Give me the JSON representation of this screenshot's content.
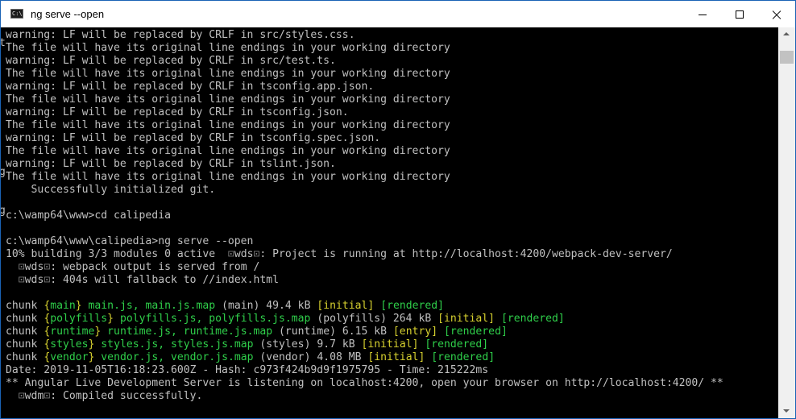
{
  "window": {
    "title": "ng serve --open",
    "icon": "cmd-icon",
    "icon_glyph": "C:\\",
    "buttons": {
      "minimize": "minimize-icon",
      "maximize": "maximize-icon",
      "close": "close-icon"
    }
  },
  "terminal": {
    "lines": [
      {
        "segments": [
          {
            "text": "warning: LF will be replaced by CRLF in src/styles.css."
          }
        ]
      },
      {
        "segments": [
          {
            "text": "The file will have its original line endings in your working directory"
          }
        ]
      },
      {
        "segments": [
          {
            "text": "warning: LF will be replaced by CRLF in src/test.ts."
          }
        ]
      },
      {
        "segments": [
          {
            "text": "The file will have its original line endings in your working directory"
          }
        ]
      },
      {
        "segments": [
          {
            "text": "warning: LF will be replaced by CRLF in tsconfig.app.json."
          }
        ]
      },
      {
        "segments": [
          {
            "text": "The file will have its original line endings in your working directory"
          }
        ]
      },
      {
        "segments": [
          {
            "text": "warning: LF will be replaced by CRLF in tsconfig.json."
          }
        ]
      },
      {
        "segments": [
          {
            "text": "The file will have its original line endings in your working directory"
          }
        ]
      },
      {
        "segments": [
          {
            "text": "warning: LF will be replaced by CRLF in tsconfig.spec.json."
          }
        ]
      },
      {
        "segments": [
          {
            "text": "The file will have its original line endings in your working directory"
          }
        ]
      },
      {
        "segments": [
          {
            "text": "warning: LF will be replaced by CRLF in tslint.json."
          }
        ]
      },
      {
        "segments": [
          {
            "text": "The file will have its original line endings in your working directory"
          }
        ]
      },
      {
        "segments": [
          {
            "text": "    Successfully initialized git."
          }
        ]
      },
      {
        "segments": [
          {
            "text": ""
          }
        ]
      },
      {
        "segments": [
          {
            "text": "c:\\wamp64\\www>cd calipedia"
          }
        ]
      },
      {
        "segments": [
          {
            "text": ""
          }
        ]
      },
      {
        "segments": [
          {
            "text": "c:\\wamp64\\www\\calipedia>ng serve --open"
          }
        ]
      },
      {
        "segments": [
          {
            "text": "10% building 3/3 modules 0 active "
          },
          {
            "text": " ",
            "c": "box-glyph"
          },
          {
            "text": "⊡",
            "c": "box-glyph"
          },
          {
            "text": "wds"
          },
          {
            "text": "⊡",
            "c": "box-glyph"
          },
          {
            "text": ": Project is running at http://localhost:4200/webpack-dev-server/"
          }
        ]
      },
      {
        "segments": [
          {
            "text": "  ",
            "c": "box-glyph"
          },
          {
            "text": "⊡",
            "c": "box-glyph"
          },
          {
            "text": "wds"
          },
          {
            "text": "⊡",
            "c": "box-glyph"
          },
          {
            "text": ": webpack output is served from /"
          }
        ]
      },
      {
        "segments": [
          {
            "text": "  ",
            "c": "box-glyph"
          },
          {
            "text": "⊡",
            "c": "box-glyph"
          },
          {
            "text": "wds"
          },
          {
            "text": "⊡",
            "c": "box-glyph"
          },
          {
            "text": ": 404s will fallback to //index.html"
          }
        ]
      },
      {
        "segments": [
          {
            "text": ""
          }
        ]
      },
      {
        "segments": [
          {
            "text": "chunk "
          },
          {
            "text": "{",
            "c": "yellow"
          },
          {
            "text": "main",
            "c": "green"
          },
          {
            "text": "}",
            "c": "yellow"
          },
          {
            "text": " "
          },
          {
            "text": "main.js, main.js.map",
            "c": "green"
          },
          {
            "text": " (main) 49.4 kB "
          },
          {
            "text": "[initial]",
            "c": "yellow"
          },
          {
            "text": " "
          },
          {
            "text": "[rendered]",
            "c": "green"
          }
        ]
      },
      {
        "segments": [
          {
            "text": "chunk "
          },
          {
            "text": "{",
            "c": "yellow"
          },
          {
            "text": "polyfills",
            "c": "green"
          },
          {
            "text": "}",
            "c": "yellow"
          },
          {
            "text": " "
          },
          {
            "text": "polyfills.js, polyfills.js.map",
            "c": "green"
          },
          {
            "text": " (polyfills) 264 kB "
          },
          {
            "text": "[initial]",
            "c": "yellow"
          },
          {
            "text": " "
          },
          {
            "text": "[rendered]",
            "c": "green"
          }
        ]
      },
      {
        "segments": [
          {
            "text": "chunk "
          },
          {
            "text": "{",
            "c": "yellow"
          },
          {
            "text": "runtime",
            "c": "green"
          },
          {
            "text": "}",
            "c": "yellow"
          },
          {
            "text": " "
          },
          {
            "text": "runtime.js, runtime.js.map",
            "c": "green"
          },
          {
            "text": " (runtime) 6.15 kB "
          },
          {
            "text": "[entry]",
            "c": "yellow"
          },
          {
            "text": " "
          },
          {
            "text": "[rendered]",
            "c": "green"
          }
        ]
      },
      {
        "segments": [
          {
            "text": "chunk "
          },
          {
            "text": "{",
            "c": "yellow"
          },
          {
            "text": "styles",
            "c": "green"
          },
          {
            "text": "}",
            "c": "yellow"
          },
          {
            "text": " "
          },
          {
            "text": "styles.js, styles.js.map",
            "c": "green"
          },
          {
            "text": " (styles) 9.7 kB "
          },
          {
            "text": "[initial]",
            "c": "yellow"
          },
          {
            "text": " "
          },
          {
            "text": "[rendered]",
            "c": "green"
          }
        ]
      },
      {
        "segments": [
          {
            "text": "chunk "
          },
          {
            "text": "{",
            "c": "yellow"
          },
          {
            "text": "vendor",
            "c": "green"
          },
          {
            "text": "}",
            "c": "yellow"
          },
          {
            "text": " "
          },
          {
            "text": "vendor.js, vendor.js.map",
            "c": "green"
          },
          {
            "text": " (vendor) 4.08 MB "
          },
          {
            "text": "[initial]",
            "c": "yellow"
          },
          {
            "text": " "
          },
          {
            "text": "[rendered]",
            "c": "green"
          }
        ]
      },
      {
        "segments": [
          {
            "text": "Date: 2019-11-05T16:18:23.600Z - Hash: c973f424b9d9f1975795 - Time: 215222ms"
          }
        ]
      },
      {
        "segments": [
          {
            "text": "** Angular Live Development Server is listening on localhost:4200, open your browser on http://localhost:4200/ **"
          }
        ]
      },
      {
        "segments": [
          {
            "text": "  ",
            "c": "box-glyph"
          },
          {
            "text": "⊡",
            "c": "box-glyph"
          },
          {
            "text": "wdm"
          },
          {
            "text": "⊡",
            "c": "box-glyph"
          },
          {
            "text": ": Compiled successfully."
          }
        ]
      }
    ],
    "edge_chars": [
      {
        "text": "t",
        "line": 0
      },
      {
        "text": "g",
        "line": 10
      },
      {
        "text": "g",
        "line": 13
      }
    ]
  },
  "colors": {
    "text": "#c0c0c0",
    "cyan": "#3ab0c3",
    "green": "#2fcf4a",
    "yellow": "#d6d02f",
    "background": "#000000",
    "border": "#1a63b5"
  }
}
